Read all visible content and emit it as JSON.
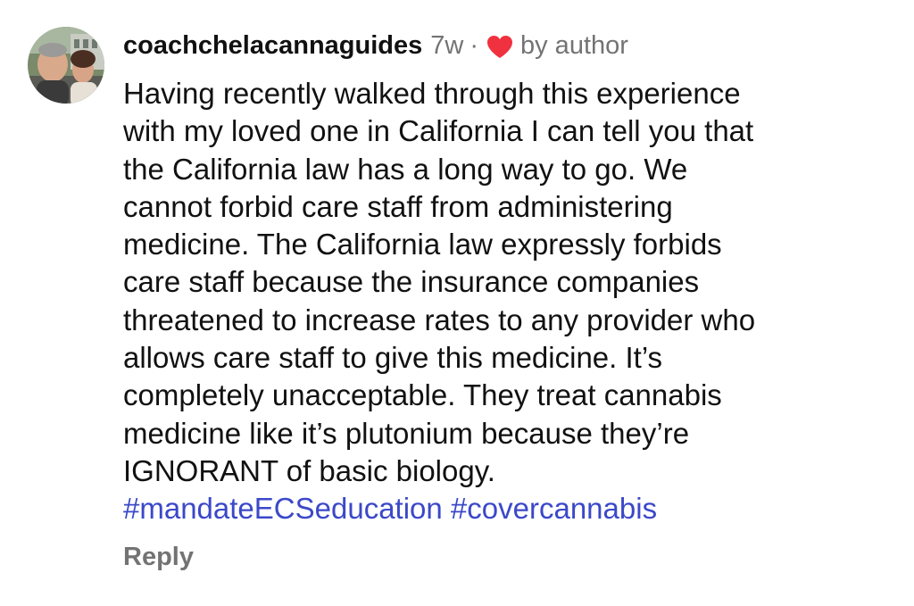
{
  "comment": {
    "username": "coachchelacannaguides",
    "time_ago": "7w",
    "separator": "·",
    "liked_by_label": "by author",
    "heart_icon": "red-heart-icon",
    "heart_color": "#f0313f",
    "body_lines": [
      "Having recently walked through this experience",
      "with my loved one in California I can tell you that",
      "the California law has a long way to go. We",
      "cannot forbid care staff from administering",
      "medicine. The California law expressly forbids",
      "care staff because the insurance companies",
      "threatened to increase rates to any provider who",
      "allows care staff to give this medicine. It’s",
      "completely unacceptable. They treat cannabis",
      "medicine like it’s plutonium because they’re",
      "IGNORANT of basic biology."
    ],
    "hashtags": [
      "#mandateECSeducation",
      "#covercannabis"
    ],
    "hashtag_color": "#3b48c9",
    "reply_label": "Reply"
  }
}
